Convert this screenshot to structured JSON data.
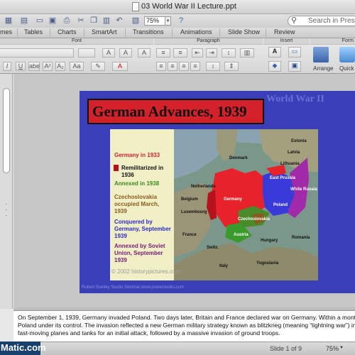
{
  "window": {
    "title": "03 World War II Lecture.ppt"
  },
  "toolbar": {
    "zoom": "75%",
    "search_placeholder": "Search in Presentation"
  },
  "ribbon": {
    "tabs": [
      "mes",
      "Tables",
      "Charts",
      "SmartArt",
      "Transitions",
      "Animations",
      "Slide Show",
      "Review"
    ],
    "groups": {
      "font": "Font",
      "paragraph": "Paragraph",
      "insert": "Insert",
      "format": "Form"
    },
    "arrange_label": "Arrange",
    "quick_label": "Quick"
  },
  "slide": {
    "corner_title": "World War II",
    "title": "German Advances, 1939",
    "legend": [
      {
        "text": "Germany in 1933",
        "color": "#d0222a"
      },
      {
        "text": "Remilitarized in 1936",
        "color": "#111111"
      },
      {
        "text": "Annexed in 1938",
        "color": "#3a8a1e"
      },
      {
        "text": "Czechoslovakia occupied March, 1939",
        "color": "#8a5a1e"
      },
      {
        "text": "Conquered by Germany, September 1939",
        "color": "#2a2ad0"
      },
      {
        "text": "Annexed by Soviet Union, September 1939",
        "color": "#7a1a7a"
      }
    ],
    "copyright": "© 2002 historypictures.com",
    "footer": "Robert Stanley Studio Seminar  www.powerstudio.com",
    "map_labels": {
      "denmark": "Denmark",
      "netherlands": "Netherlands",
      "germany": "Germany",
      "poland": "Poland",
      "east_prussia": "East Prussia",
      "white_russia": "White Russia",
      "lithuania": "Lithuania",
      "latvia": "Latvia",
      "estonia": "Estonia",
      "luxembourg": "Luxembourg",
      "belgium": "Belgium",
      "france": "France",
      "czech": "Czechoslovakia",
      "austria": "Austria",
      "hungary": "Hungary",
      "romania": "Romania",
      "yugoslavia": "Yugoslavia",
      "italy": "Italy",
      "switzerland": "Switz."
    }
  },
  "notes": {
    "text": "On September 1, 1939, Germany invaded Poland. Two days later, Britain and France declared war on Germany. Within a month, Poland under its control. The invasion reflected a new German military strategy known as blitzkrieg (meaning “lightning war”) in w fast-moving planes and tanks for an initial attack, followed by a massive invasion of ground troops."
  },
  "status": {
    "slide": "Slide 1 of 9",
    "zoom": "75%"
  },
  "watermark": "Matic.com"
}
